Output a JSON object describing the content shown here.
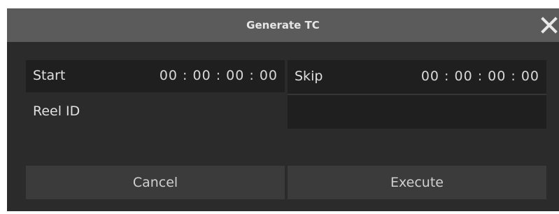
{
  "dialog": {
    "title": "Generate TC",
    "close_icon": "close-icon"
  },
  "fields": {
    "start": {
      "label": "Start",
      "value": "00 : 00 : 00 : 00"
    },
    "skip": {
      "label": "Skip",
      "value": "00 : 00 : 00 : 00"
    },
    "reel_id": {
      "label": "Reel ID"
    }
  },
  "buttons": {
    "cancel": "Cancel",
    "execute": "Execute"
  },
  "colors": {
    "titlebar": "#5b5b5b",
    "background": "#2b2b2b",
    "field": "#1f1f1f",
    "button": "#3b3b3b",
    "text": "#e0e0e0"
  }
}
